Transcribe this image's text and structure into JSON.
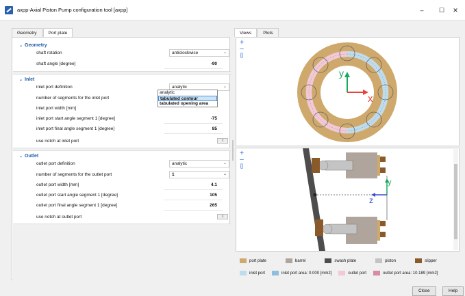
{
  "window": {
    "title": "axpp-Axial Piston Pump configuration tool [axpp]",
    "minimize": "–",
    "maximize": "☐",
    "close": "✕"
  },
  "left_tabs": [
    "Geometry",
    "Port plate"
  ],
  "left_active_tab": "Port plate",
  "right_tabs": [
    "Views",
    "Plots"
  ],
  "right_active_tab": "Views",
  "geometry": {
    "header": "Geometry",
    "shaft_rotation_label": "shaft rotation",
    "shaft_rotation_value": "anticlockwise",
    "shaft_angle_label": "shaft angle [degree]",
    "shaft_angle_value": "-90"
  },
  "inlet": {
    "header": "Inlet",
    "definition_label": "inlet port definition",
    "definition_value": "analytic",
    "segments_label": "number of segments for the inlet port",
    "width_label": "inlet port width [mm]",
    "start_angle_label": "inlet port start angle segment 1 [degree]",
    "start_angle_value": "-75",
    "final_angle_label": "inlet port final angle segment 1 [degree]",
    "final_angle_value": "85",
    "notch_label": "use notch at inlet port"
  },
  "dropdown_options": [
    "analytic",
    "tabulated contour",
    "tabulated opening area"
  ],
  "dropdown_highlighted": "tabulated contour",
  "outlet": {
    "header": "Outlet",
    "definition_label": "outlet port definition",
    "definition_value": "analytic",
    "segments_label": "number of segments for the outlet port",
    "segments_value": "1",
    "width_label": "outlet port width [mm]",
    "width_value": "4.1",
    "start_angle_label": "outlet port start angle segment 1 [degree]",
    "start_angle_value": "105",
    "final_angle_label": "outlet port final angle segment 1 [degree]",
    "final_angle_value": "265",
    "notch_label": "use notch at outlet port"
  },
  "views": {
    "zoom_in": "+",
    "zoom_out": "–",
    "fit": "[]",
    "axis_y": "y",
    "axis_x": "x",
    "axis_z": "z"
  },
  "legend": [
    {
      "label": "port plate",
      "color": "#cfa86b"
    },
    {
      "label": "barrel",
      "color": "#b0a59c"
    },
    {
      "label": "swash plate",
      "color": "#4d4d4d"
    },
    {
      "label": "piston",
      "color": "#c4c4c4"
    },
    {
      "label": "slipper",
      "color": "#8a5a2b"
    },
    {
      "label": "inlet port",
      "color": "#bfdcec"
    },
    {
      "label": "inlet port area: 0.000 [mm2]",
      "color": "#8ec0dd"
    },
    {
      "label": "outlet port",
      "color": "#f2c9d6"
    },
    {
      "label": "outlet port area: 10.189 [mm2]",
      "color": "#d98aa6"
    }
  ],
  "buttons": {
    "close": "Close",
    "help": "Help"
  },
  "toggle_text": "X"
}
